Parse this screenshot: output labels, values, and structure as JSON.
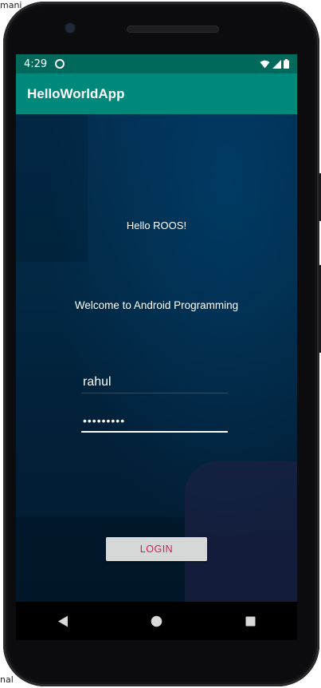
{
  "edge": {
    "top_text": "mani",
    "bottom_text": "nal"
  },
  "status_bar": {
    "time": "4:29",
    "icons": [
      "app-notification-icon",
      "wifi-icon",
      "cellular-signal-icon",
      "battery-icon"
    ]
  },
  "app_bar": {
    "title": "HelloWorldApp"
  },
  "main": {
    "hello_text": "Hello ROOS!",
    "welcome_text": "Welcome to Android Programming",
    "username": {
      "value": "rahul"
    },
    "password": {
      "value": "•••••••••"
    },
    "login_label": "LOGIN"
  },
  "nav_bar": {
    "icons": [
      "back-icon",
      "home-icon",
      "recents-icon"
    ]
  },
  "colors": {
    "status_bar": "#00695c",
    "app_bar": "#00897b",
    "accent": "#d81b60",
    "button_bg": "#d6d7d7"
  }
}
